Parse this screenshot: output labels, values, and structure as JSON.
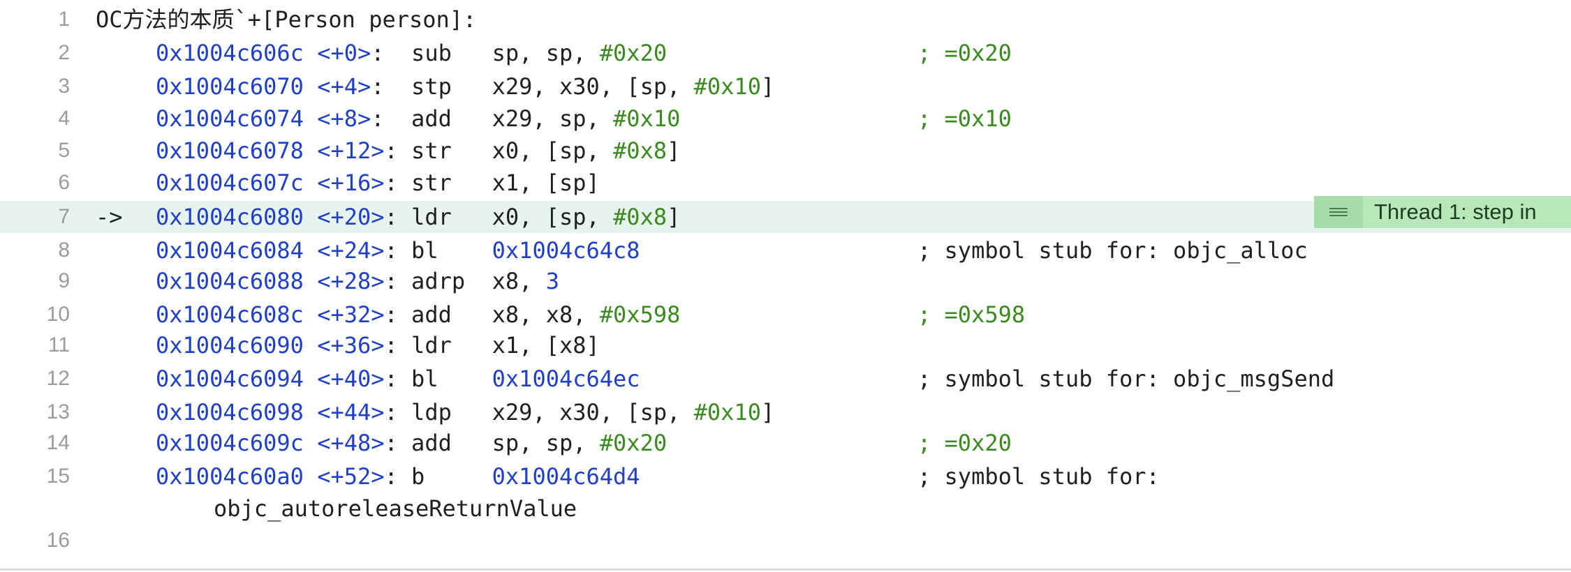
{
  "title_line": "OC方法的本质`+[Person person]:",
  "lines": [
    {
      "n": "1"
    },
    {
      "n": "2",
      "marker": "",
      "addr": "0x1004c606c",
      "off": "<+0>",
      "sep": ":  ",
      "op": "sub ",
      "args": [
        {
          "t": "sp, sp, ",
          "c": ""
        },
        {
          "t": "#0x20",
          "c": "imm"
        }
      ],
      "comment": "; =0x20",
      "comment_color": "green"
    },
    {
      "n": "3",
      "marker": "",
      "addr": "0x1004c6070",
      "off": "<+4>",
      "sep": ":  ",
      "op": "stp ",
      "args": [
        {
          "t": "x29, x30, [sp, ",
          "c": ""
        },
        {
          "t": "#0x10",
          "c": "imm"
        },
        {
          "t": "]",
          "c": ""
        }
      ]
    },
    {
      "n": "4",
      "marker": "",
      "addr": "0x1004c6074",
      "off": "<+8>",
      "sep": ":  ",
      "op": "add ",
      "args": [
        {
          "t": "x29, sp, ",
          "c": ""
        },
        {
          "t": "#0x10",
          "c": "imm"
        }
      ],
      "comment": "; =0x10",
      "comment_color": "green"
    },
    {
      "n": "5",
      "marker": "",
      "addr": "0x1004c6078",
      "off": "<+12>",
      "sep": ": ",
      "op": "str ",
      "args": [
        {
          "t": "x0, [sp, ",
          "c": ""
        },
        {
          "t": "#0x8",
          "c": "imm"
        },
        {
          "t": "]",
          "c": ""
        }
      ]
    },
    {
      "n": "6",
      "marker": "",
      "addr": "0x1004c607c",
      "off": "<+16>",
      "sep": ": ",
      "op": "str ",
      "args": [
        {
          "t": "x1, [sp]",
          "c": ""
        }
      ]
    },
    {
      "n": "7",
      "marker": "->",
      "addr": "0x1004c6080",
      "off": "<+20>",
      "sep": ": ",
      "op": "ldr ",
      "args": [
        {
          "t": "x0, [sp, ",
          "c": ""
        },
        {
          "t": "#0x8",
          "c": "imm"
        },
        {
          "t": "]",
          "c": ""
        }
      ],
      "current": true
    },
    {
      "n": "8",
      "marker": "",
      "addr": "0x1004c6084",
      "off": "<+24>",
      "sep": ": ",
      "op": "bl  ",
      "args": [
        {
          "t": "0x1004c64c8",
          "c": "addr"
        }
      ],
      "comment": "; symbol stub for: objc_alloc",
      "comment_color": "dark"
    },
    {
      "n": "9",
      "marker": "",
      "addr": "0x1004c6088",
      "off": "<+28>",
      "sep": ": ",
      "op": "adrp",
      "args": [
        {
          "t": "x8, ",
          "c": ""
        },
        {
          "t": "3",
          "c": "addr"
        }
      ]
    },
    {
      "n": "10",
      "marker": "",
      "addr": "0x1004c608c",
      "off": "<+32>",
      "sep": ": ",
      "op": "add ",
      "args": [
        {
          "t": "x8, x8, ",
          "c": ""
        },
        {
          "t": "#0x598",
          "c": "imm"
        }
      ],
      "comment": "; =0x598",
      "comment_color": "green"
    },
    {
      "n": "11",
      "marker": "",
      "addr": "0x1004c6090",
      "off": "<+36>",
      "sep": ": ",
      "op": "ldr ",
      "args": [
        {
          "t": "x1, [x8]",
          "c": ""
        }
      ]
    },
    {
      "n": "12",
      "marker": "",
      "addr": "0x1004c6094",
      "off": "<+40>",
      "sep": ": ",
      "op": "bl  ",
      "args": [
        {
          "t": "0x1004c64ec",
          "c": "addr"
        }
      ],
      "comment": "; symbol stub for: objc_msgSend",
      "comment_color": "dark"
    },
    {
      "n": "13",
      "marker": "",
      "addr": "0x1004c6098",
      "off": "<+44>",
      "sep": ": ",
      "op": "ldp ",
      "args": [
        {
          "t": "x29, x30, [sp, ",
          "c": ""
        },
        {
          "t": "#0x10",
          "c": "imm"
        },
        {
          "t": "]",
          "c": ""
        }
      ]
    },
    {
      "n": "14",
      "marker": "",
      "addr": "0x1004c609c",
      "off": "<+48>",
      "sep": ": ",
      "op": "add ",
      "args": [
        {
          "t": "sp, sp, ",
          "c": ""
        },
        {
          "t": "#0x20",
          "c": "imm"
        }
      ],
      "comment": "; =0x20",
      "comment_color": "green"
    },
    {
      "n": "15",
      "marker": "",
      "addr": "0x1004c60a0",
      "off": "<+52>",
      "sep": ": ",
      "op": "b   ",
      "args": [
        {
          "t": "0x1004c64d4",
          "c": "addr"
        }
      ],
      "comment": "; symbol stub for:",
      "comment_color": "dark",
      "wrap": "objc_autoreleaseReturnValue"
    },
    {
      "n": "16"
    }
  ],
  "badge": {
    "text": "Thread 1: step in",
    "icon": "lines-icon"
  },
  "colors": {
    "address": "#1e3fc6",
    "immediate": "#3a8a1f",
    "current_line_bg": "#e6f3ef",
    "badge_bg": "#b8e8b9"
  }
}
